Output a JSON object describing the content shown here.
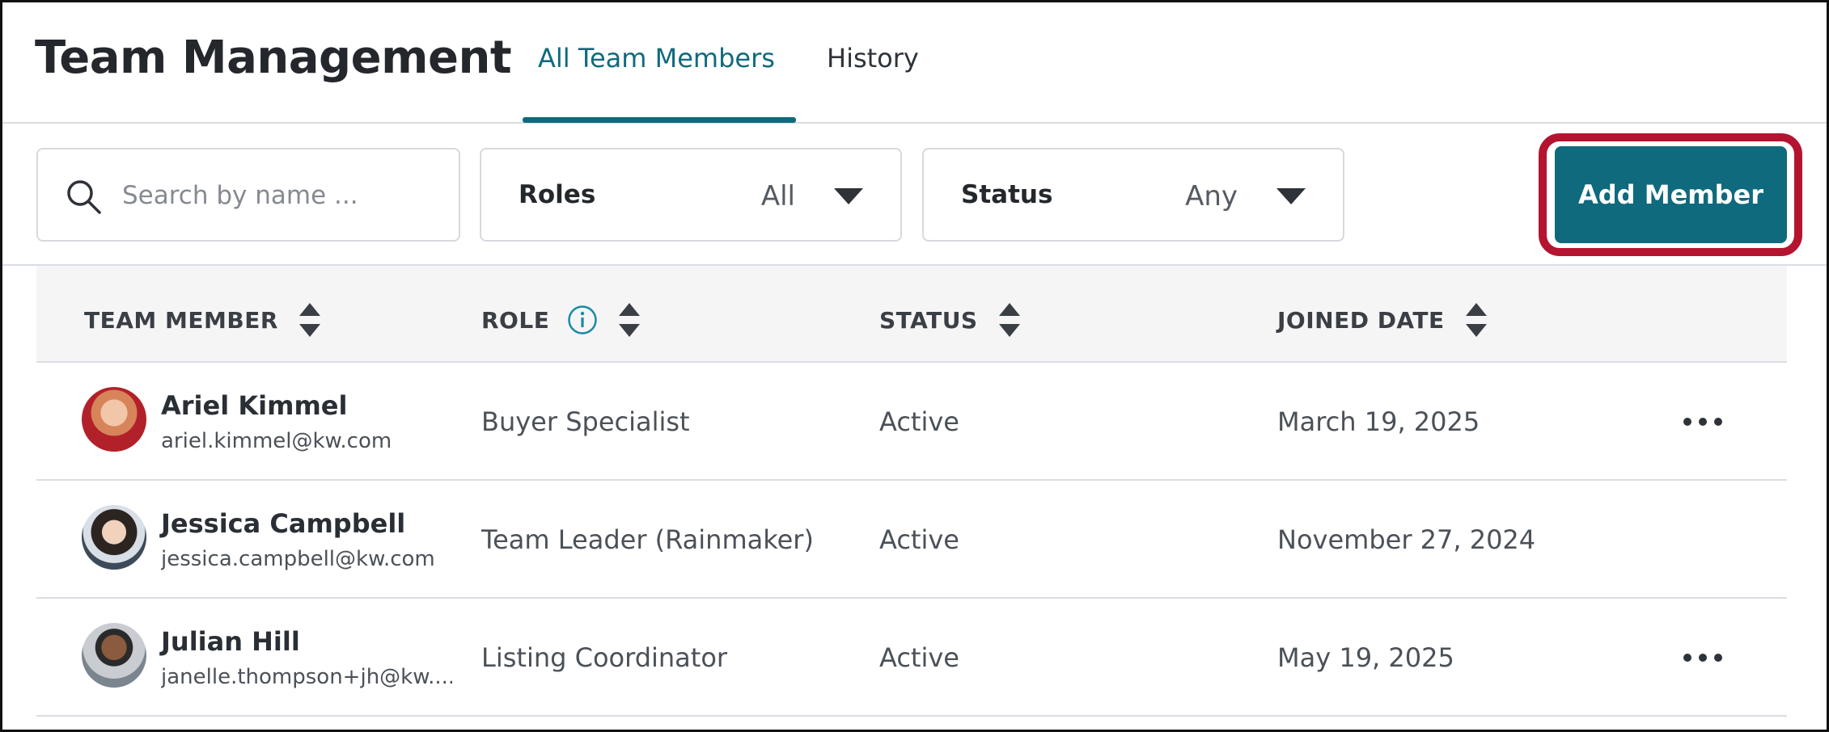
{
  "header": {
    "title": "Team Management",
    "tabs": [
      {
        "label": "All Team Members",
        "active": true
      },
      {
        "label": "History",
        "active": false
      }
    ]
  },
  "toolbar": {
    "search": {
      "placeholder": "Search by name ...",
      "value": "",
      "icon": "search-icon"
    },
    "roles_filter": {
      "label": "Roles",
      "value": "All",
      "icon": "caret-down-icon"
    },
    "status_filter": {
      "label": "Status",
      "value": "Any",
      "icon": "caret-down-icon"
    },
    "add_button_label": "Add Member"
  },
  "table": {
    "columns": [
      {
        "label": "TEAM MEMBER",
        "sortable": true
      },
      {
        "label": "ROLE",
        "sortable": true,
        "info": true
      },
      {
        "label": "STATUS",
        "sortable": true
      },
      {
        "label": "JOINED DATE",
        "sortable": true
      }
    ],
    "rows": [
      {
        "name": "Ariel Kimmel",
        "email": "ariel.kimmel@kw.com",
        "role": "Buyer Specialist",
        "status": "Active",
        "joined": "March 19, 2025",
        "has_menu": true
      },
      {
        "name": "Jessica Campbell",
        "email": "jessica.campbell@kw.com",
        "role": "Team Leader (Rainmaker)",
        "status": "Active",
        "joined": "November 27, 2024",
        "has_menu": false
      },
      {
        "name": "Julian Hill",
        "email": "janelle.thompson+jh@kw....",
        "role": "Listing Coordinator",
        "status": "Active",
        "joined": "May 19, 2025",
        "has_menu": true
      }
    ]
  },
  "colors": {
    "accent": "#0e6a7c",
    "highlight_ring": "#b4142f",
    "border": "#d9dde2",
    "header_bg": "#f5f5f6"
  }
}
